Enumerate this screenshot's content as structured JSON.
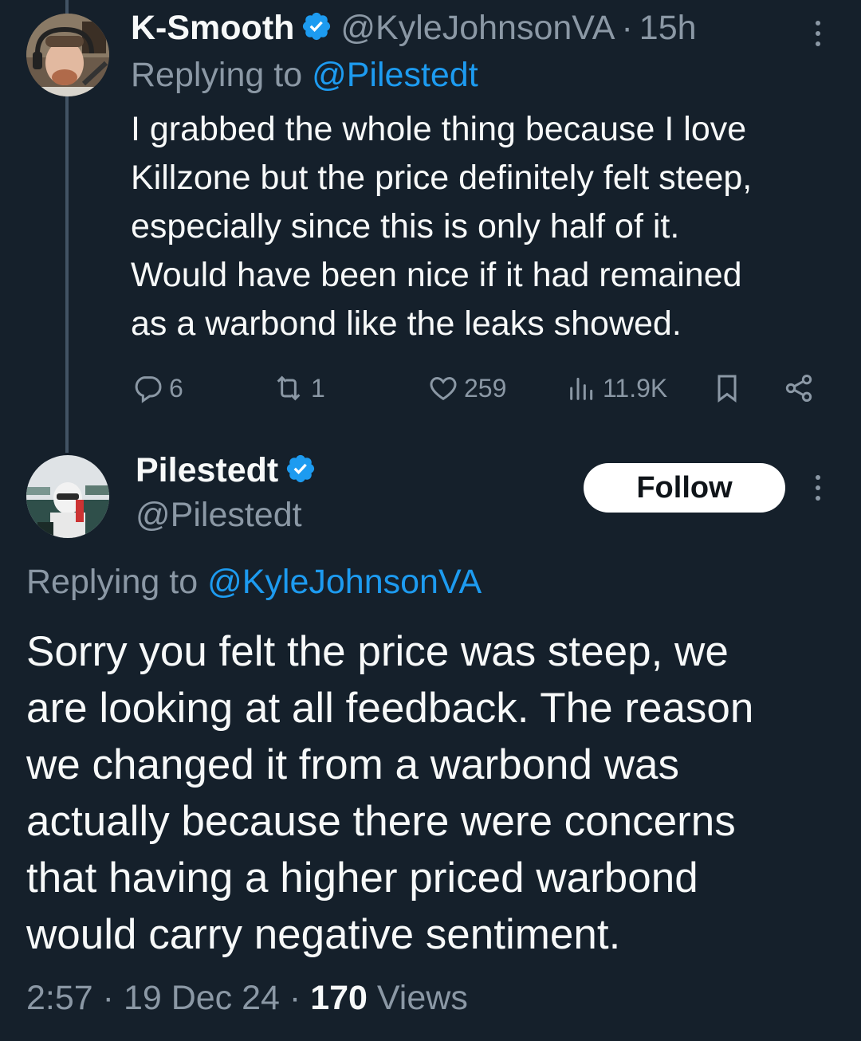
{
  "reply_tweet": {
    "display_name": "K-Smooth",
    "handle": "@KyleJohnsonVA",
    "separator": "·",
    "time": "15h",
    "replying_prefix": "Replying to",
    "replying_to": "@Pilestedt",
    "text": "I grabbed the whole thing because I love\nKillzone but the price definitely felt steep,\nespecially since this is only half of it.\nWould have been nice if it had remained\nas a warbond like the leaks showed.",
    "stats": {
      "replies": "6",
      "reposts": "1",
      "likes": "259",
      "views": "11.9K"
    }
  },
  "main_tweet": {
    "display_name": "Pilestedt",
    "handle": "@Pilestedt",
    "follow_label": "Follow",
    "replying_prefix": "Replying to",
    "replying_to": "@KyleJohnsonVA",
    "text": "Sorry you felt the price was steep, we\nare looking at all feedback. The reason\nwe changed it from a warbond was\nactually because there were concerns\nthat having a higher priced warbond\nwould carry negative sentiment.",
    "time": "2:57",
    "date": "19 Dec 24",
    "separator": "·",
    "views_count": "170",
    "views_label": "Views"
  },
  "icons": {
    "verified": "verified-badge-icon",
    "more": "more-icon",
    "reply": "reply-icon",
    "repost": "repost-icon",
    "like": "heart-icon",
    "views": "views-icon",
    "bookmark": "bookmark-icon",
    "share": "share-icon"
  },
  "colors": {
    "background": "#15202b",
    "text": "#f7f9f9",
    "muted": "#8b98a5",
    "accent": "#1d9bf0",
    "thread_line": "#425364",
    "follow_bg": "#ffffff"
  }
}
